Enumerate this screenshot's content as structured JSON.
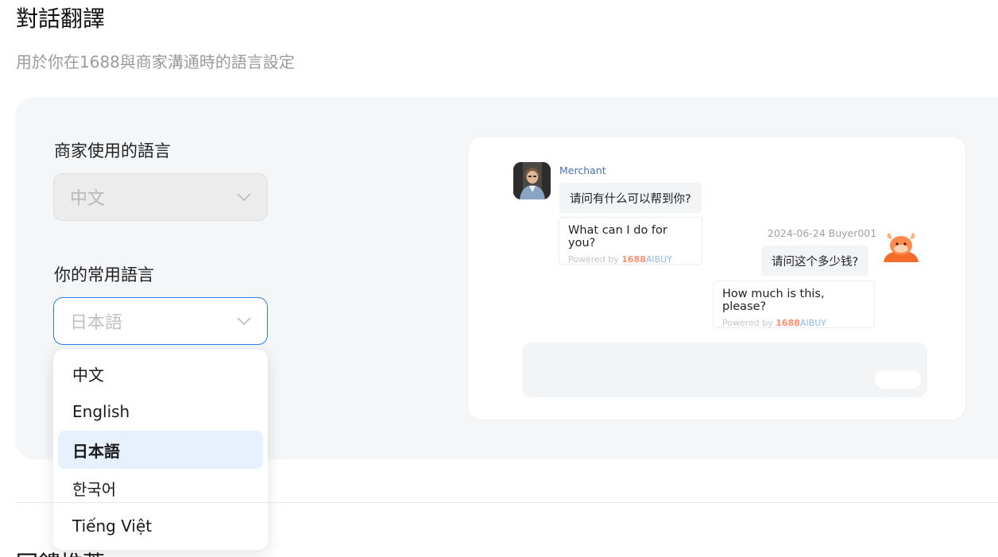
{
  "page": {
    "title": "對話翻譯",
    "subtitle": "用於你在1688與商家溝通時的語言設定"
  },
  "merchant_language": {
    "label": "商家使用的語言",
    "value": "中文"
  },
  "my_language": {
    "label": "你的常用語言",
    "value": "日本語",
    "options": [
      {
        "label": "中文"
      },
      {
        "label": "English"
      },
      {
        "label": "日本語"
      },
      {
        "label": "한국어"
      },
      {
        "label": "Tiếng Việt"
      }
    ]
  },
  "preview": {
    "merchant_name": "Merchant",
    "merchant_message": "请问有什么可以帮到你?",
    "merchant_translation": "What can I do for you?",
    "buyer_meta": "2024-06-24 Buyer001",
    "buyer_message": "请问这个多少钱?",
    "buyer_translation": "How much is this, please?",
    "powered_prefix": "Powered by",
    "brand_part1": "1688",
    "brand_part2": "AIBUY"
  },
  "next_section": {
    "title": "回饋推薦"
  },
  "colors": {
    "accent": "#2b7de9",
    "selected_bg": "#e6f1fd",
    "card_bg": "#f5f6f8"
  }
}
